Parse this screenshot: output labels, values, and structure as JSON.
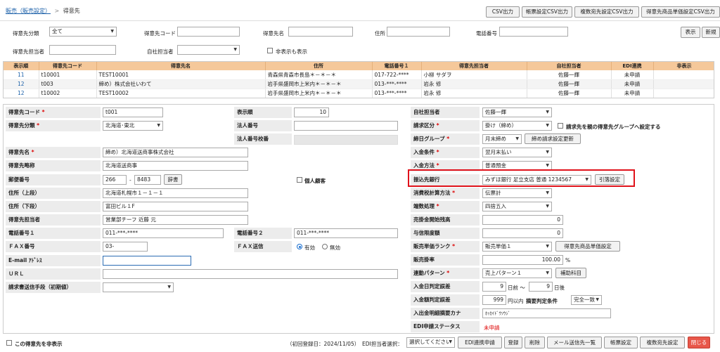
{
  "breadcrumb": {
    "parent": "販売（販売設定）",
    "sep": ">",
    "current": "得意先"
  },
  "toolbar": [
    "CSV出力",
    "帳票設定CSV出力",
    "複数宛先設定CSV出力",
    "得意先商品単価設定CSV出力"
  ],
  "search": {
    "category_label": "得意先分類",
    "category_value": "全て",
    "code_label": "得意先コード",
    "code_value": "",
    "name_label": "得意先名",
    "name_value": "",
    "address_label": "住所",
    "address_value": "",
    "phone_label": "電話番号",
    "phone_value": "",
    "staff_label": "得意先担当者",
    "staff_value": "",
    "own_staff_label": "自社担当者",
    "own_staff_value": "",
    "hidden_label": "非表示も表示",
    "show_btn": "表示",
    "new_btn": "新規"
  },
  "grid": {
    "columns": [
      "表示順",
      "得意先コード",
      "得意先名",
      "住所",
      "電話番号１",
      "得意先担当者",
      "自社担当者",
      "EDI連携",
      "非表示"
    ],
    "rows": [
      [
        "11",
        "t10001",
        "TEST10001",
        "青森県青森市長島＊－＊－＊",
        "017-722-****",
        "小柳 サダヲ",
        "佐藤一輝",
        "未申請",
        ""
      ],
      [
        "12",
        "t003",
        "締め）株式会社いわて",
        "岩手県盛岡市上米内＊－＊－＊",
        "013-***-****",
        "岩永 修",
        "佐藤一輝",
        "未申請",
        ""
      ],
      [
        "12",
        "t10002",
        "TEST10002",
        "岩手県盛岡市上米内＊－＊－＊",
        "013-***-****",
        "岩永 修",
        "佐藤一輝",
        "未申請",
        ""
      ]
    ]
  },
  "form": {
    "code_label": "得意先コード",
    "code": "t001",
    "order_label": "表示順",
    "order": "10",
    "own_staff_label": "自社担当者",
    "own_staff": "佐藤一輝",
    "class_label": "得意先分類",
    "class": "北海道･東北",
    "corp_no_label": "法人番号",
    "corp_no": "",
    "billing_label": "請求区分",
    "billing": "掛け（締め）",
    "parent_group_label": "請求先を親の得意先グループへ設定する",
    "corp_check_label": "法人番号校番",
    "closing_group_label": "締日グループ",
    "closing_group": "月末締め",
    "closing_btn": "締め請求設定更新",
    "name_label": "得意先名",
    "name": "締め）北海道送商事株式会社",
    "short_label": "得意先略称",
    "short": "北海道送商事",
    "receive_cond_label": "入金条件",
    "receive_cond": "翌月末払い",
    "receive_method_label": "入金方法",
    "receive_method": "普通預金",
    "zip_label": "郵便番号",
    "zip1": "266",
    "zip_sep": "-",
    "zip2": "8483",
    "dict_btn": "辞書",
    "personal_label": "個人顧客",
    "bank_label": "振込先銀行",
    "bank": "みずほ銀行 足立支店 普通 1234567",
    "pull_btn": "引落設定",
    "addr1_label": "住所（上段）",
    "addr1": "北海道札幌市１－１－１",
    "tax_calc_label": "消費税計算方法",
    "tax_calc": "伝票計",
    "addr2_label": "住所（下段）",
    "addr2": "富田ビル１F",
    "rounding_label": "端数処理",
    "rounding": "四捨五入",
    "contact_label": "得意先担当者",
    "contact": "営業部チーフ 近藤 元",
    "ar_start_label": "売掛金開始残高",
    "ar_start": "0",
    "tel1_label": "電話番号１",
    "tel1": "011-***-****",
    "tel2_label": "電話番号２",
    "tel2": "011-***-****",
    "credit_label": "与信限度額",
    "credit": "0",
    "fax_label": "ＦＡＸ番号",
    "fax": "03-",
    "fax_send_label": "ＦＡＸ送信",
    "fax_on": "有効",
    "fax_off": "無効",
    "rank_label": "販売単価ランク",
    "rank": "販売単価１",
    "rank_btn": "得意先商品単価設定",
    "email_label": "E-mail ｱﾄﾞﾚｽ",
    "email": "",
    "rate_label": "販売掛率",
    "rate": "100.00",
    "rate_unit": "%",
    "url_label": "ＵＲＬ",
    "url": "",
    "link_label": "連動パターン",
    "link": "売上パターン１",
    "aux_btn": "補助科目",
    "send_label": "請求書送信手段（初期値）",
    "send": "",
    "day_judge_label": "入金日判定誤差",
    "day_before": "9",
    "day_before_unit": "日前 ～",
    "day_after": "9",
    "day_after_unit": "日後",
    "amount_judge_label": "入金額判定誤差",
    "amount_judge": "999",
    "amount_unit": "円以内",
    "summary_cond_label": "摘要判定条件",
    "summary_cond": "完全一致",
    "kana_label": "入出金明細摘要カナ",
    "kana": "ﾎｯｶｲﾄﾞｳｿｳｼﾞ",
    "edi_status_label": "EDI申請ステータス",
    "edi_status": "未申請"
  },
  "footer": {
    "hide_label": "この得意先を非表示",
    "created_text": "（初回登録日：2024/11/05）",
    "edi_staff_label": "EDI担当者選択：",
    "edi_staff_value": "選択してください",
    "buttons": [
      "EDI連携申請",
      "登録",
      "削除",
      "メール送信先一覧",
      "帳票設定",
      "複数宛先設定",
      "閉じる"
    ]
  },
  "colors": {
    "accent_red": "#e0121b",
    "header_orange": "#f5c89a",
    "close_button": "#e8574a"
  }
}
